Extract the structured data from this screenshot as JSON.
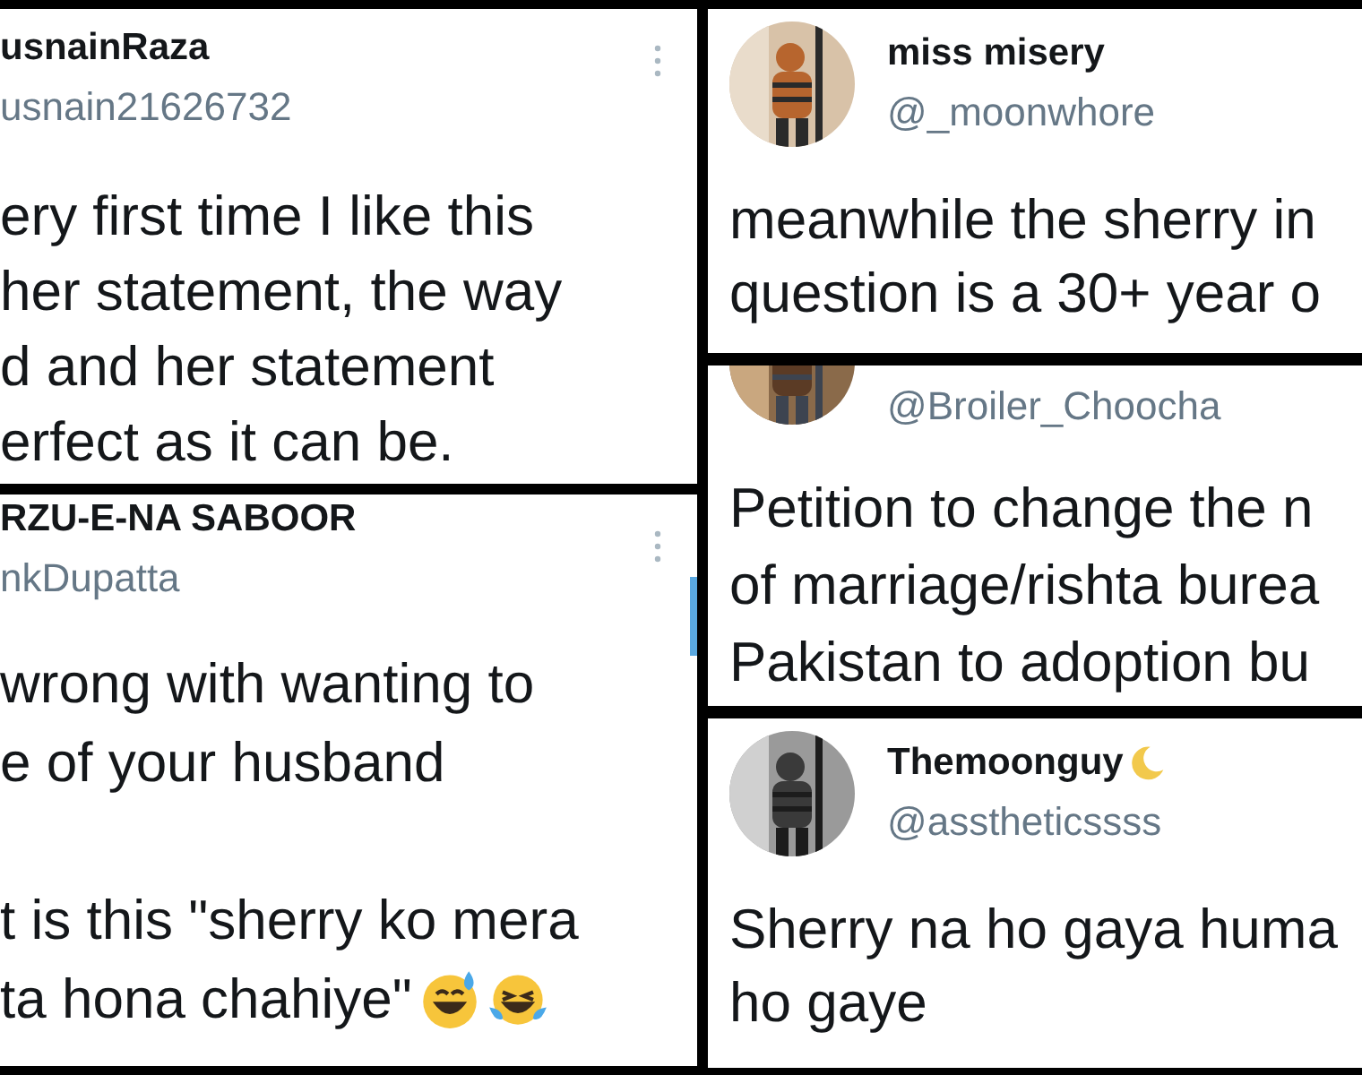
{
  "columns": [
    {
      "tweets": [
        {
          "name": "usnainRaza",
          "handle": "usnain21626732",
          "avatar": false,
          "menu": true,
          "scrollbar": false,
          "paragraphs": [
            [
              "ery first time I like this",
              "her statement, the way",
              "d and her statement",
              "erfect as it can be."
            ]
          ]
        },
        {
          "name": "RZU-E-NA SABOOR",
          "handle": "nkDupatta",
          "avatar": false,
          "menu": true,
          "scrollbar": true,
          "paragraphs": [
            [
              "wrong with wanting to",
              "e of your husband"
            ],
            [
              "t is this \"sherry ko mera",
              "ta hona chahiye\""
            ]
          ],
          "emoji_reactions": true
        }
      ]
    },
    {
      "tweets": [
        {
          "name": "miss misery",
          "handle": "@_moonwhore",
          "avatar": true,
          "menu": false,
          "scrollbar": false,
          "paragraphs": [
            [
              "meanwhile the sherry in",
              "question is a 30+ year o"
            ]
          ]
        },
        {
          "handle": "@Broiler_Choocha",
          "avatar": true,
          "menu": false,
          "scrollbar": false,
          "paragraphs": [
            [
              "Petition to change the n",
              "of marriage/rishta burea",
              "Pakistan to adoption bu"
            ]
          ]
        },
        {
          "name": "Themoonguy",
          "moon_badge": true,
          "handle": "@asstheticssss",
          "avatar": true,
          "menu": false,
          "scrollbar": false,
          "paragraphs": [
            [
              "Sherry na ho gaya huma",
              "ho gaye"
            ]
          ]
        }
      ]
    }
  ]
}
